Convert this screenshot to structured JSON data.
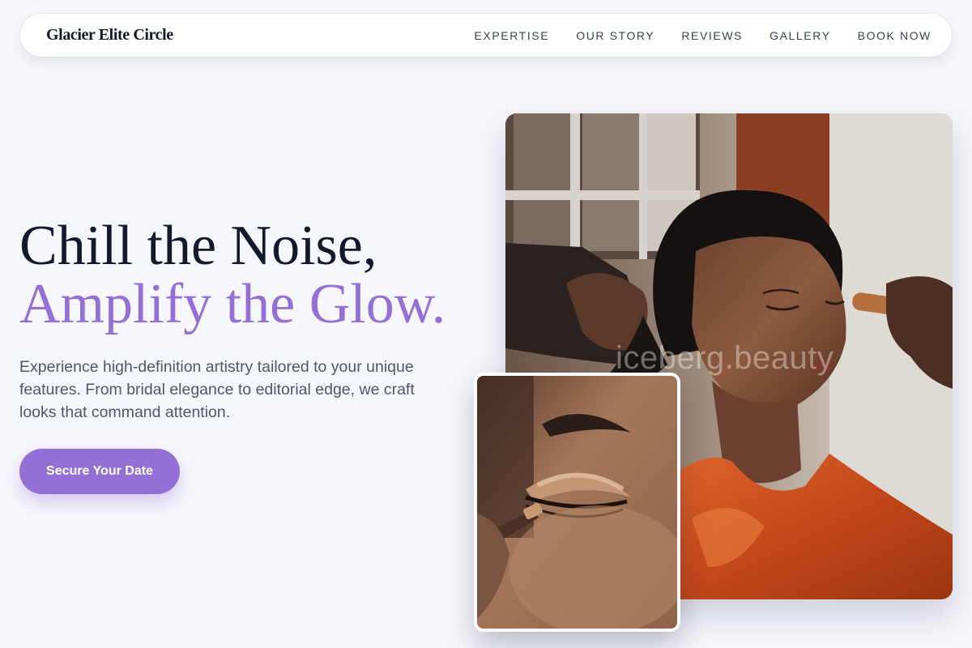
{
  "brand": {
    "name": "Glacier Elite Circle"
  },
  "nav": {
    "links": [
      "EXPERTISE",
      "OUR STORY",
      "REVIEWS",
      "GALLERY",
      "BOOK NOW"
    ]
  },
  "hero": {
    "title_line1": "Chill the Noise,",
    "title_line2": "Amplify the Glow.",
    "description": "Experience high-definition artistry tailored to your unique features. From bridal elegance to editorial edge, we craft looks that command attention.",
    "cta_label": "Secure Your Date"
  },
  "images": {
    "main_watermark": "iceberg.beauty"
  },
  "colors": {
    "accent": "#9470d6",
    "title_dark": "#141a2e",
    "body_text": "#4f5766",
    "background": "#f6f7fc"
  }
}
